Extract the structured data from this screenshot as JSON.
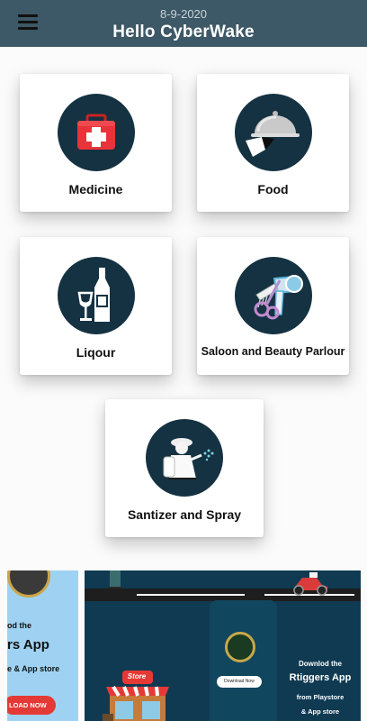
{
  "header": {
    "date": "8-9-2020",
    "greeting": "Hello CyberWake"
  },
  "categories": [
    {
      "label": "Medicine",
      "icon": "first-aid-kit-icon"
    },
    {
      "label": "Food",
      "icon": "food-cloche-icon"
    },
    {
      "label": "Liqour",
      "icon": "wine-bottle-glass-icon"
    },
    {
      "label": "Saloon and Beauty Parlour",
      "icon": "hair-dryer-comb-icon"
    },
    {
      "label": "Santizer and Spray",
      "icon": "sanitizer-sprayer-icon"
    }
  ],
  "banners": {
    "left": {
      "line1": "od the",
      "line2": "rs App",
      "line3": "e & App  store",
      "button": "LOAD NOW"
    },
    "right": {
      "sign": "Store",
      "download_button": "Download Now",
      "line1": "Downlod the",
      "line2": "Rtiggers App",
      "line3": "from  Playstore",
      "line4": "& App  store"
    }
  },
  "colors": {
    "appbar": "#3d5866",
    "icon_circle": "#153242",
    "medicine_red": "#e8333a",
    "banner_left_bg": "#9fd2f2",
    "banner_right_bg": "#0f3a52"
  }
}
